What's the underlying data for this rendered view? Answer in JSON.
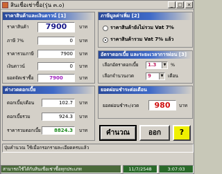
{
  "window": {
    "title": "สินเชื่อเช่าซื้อ(รุ่น ๓.๐)",
    "controls": {
      "minimize": "_",
      "maximize": "□",
      "close": "×"
    }
  },
  "price_panel": {
    "title": "ราคาสินค้าและเงินดาวน์ [1]",
    "price_label": "ราคาสินค้า",
    "price_value": "7900",
    "price_unit": "บาท",
    "vat_label": "ภาษี 7%",
    "vat_value": "0",
    "vat_unit": "บาท",
    "total_label": "ราคารวมภาษี",
    "total_value": "7900",
    "total_unit": "บาท",
    "down_label": "เงินดาวน์",
    "down_value": "0",
    "down_unit": "บาท",
    "balance_label": "ยอดจัดเช่าซื้อ",
    "balance_value": "7900",
    "balance_unit": "บาท"
  },
  "vat_panel": {
    "title": "ภาษีมูลค่าเพิ่ม [2]",
    "option_excl": "ราคาสินค้ายังไม่รวม Vat 7%",
    "option_incl": "ราคาสินค้ารวม Vat 7% แล้ว",
    "selected": "incl"
  },
  "rate_panel": {
    "title": "อัตราดอกเบี้ย และระยะเวลาการผ่อน [3]",
    "rate_label": "เลือกอัตราดอกเบี้ย",
    "rate_value": "1.3",
    "rate_unit": "%",
    "term_label": "เลือกจำนวนงวด",
    "term_value": "9",
    "term_unit": "เดือน"
  },
  "interest_panel": {
    "title": "ค่างวดดอกเบี้ย",
    "monthly_label": "ดอกเบี้ย/เดือน",
    "monthly_value": "102.7",
    "monthly_unit": "บาท",
    "total_label": "ดอกเบี้ยรวม",
    "total_value": "924.3",
    "total_unit": "บาท",
    "grand_label": "ราคารวมดอกเบี้ย",
    "grand_value": "8824.3",
    "grand_unit": "บาท"
  },
  "installment_panel": {
    "title": "ยอดผ่อนชำระต่อเดือน",
    "label": "ยอดผ่อนชำระ/งวด",
    "value": "980",
    "unit": "บาท"
  },
  "buttons": {
    "calculate": "คำนวณ",
    "exit": "ออก",
    "help": "?"
  },
  "message": "ปุ่มคำนวณ ใช้เมื่อกรอกรายละเอียดครบแล้ว",
  "status": {
    "description": "สามารถใช้ได้กับสินเชื่อเช่าซื้อทุกประเภท",
    "date": "11/7/2548",
    "time": "3:07:03"
  },
  "colors": {
    "panel_title": "#2a4a9a",
    "price_value": "#1a1a8a",
    "balance_value": "#a020c0",
    "grand_value": "#1a8a1a",
    "installment_value": "#d01010",
    "help_button": "#f0f000",
    "status_bg": "#2a6a2a"
  }
}
